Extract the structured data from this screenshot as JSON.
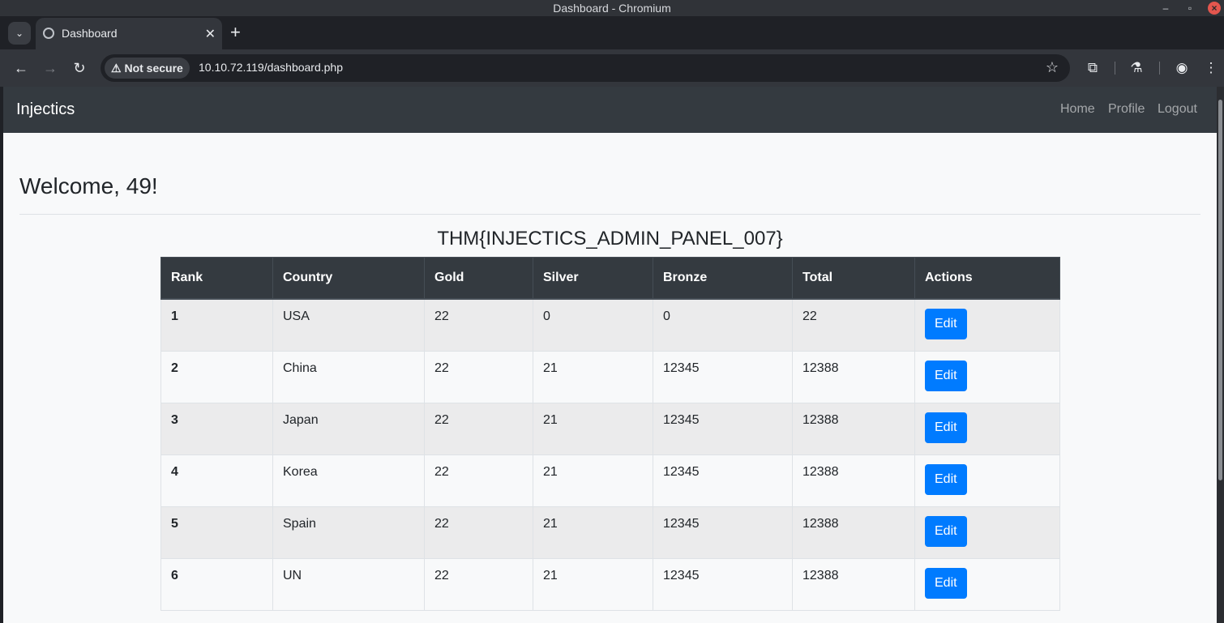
{
  "window": {
    "title": "Dashboard - Chromium"
  },
  "browser": {
    "tab_title": "Dashboard",
    "security_label": "Not secure",
    "url": "10.10.72.119/dashboard.php"
  },
  "nav": {
    "brand": "Injectics",
    "links": [
      "Home",
      "Profile",
      "Logout"
    ]
  },
  "page": {
    "welcome": "Welcome, 49!",
    "flag": "THM{INJECTICS_ADMIN_PANEL_007}"
  },
  "table": {
    "headers": [
      "Rank",
      "Country",
      "Gold",
      "Silver",
      "Bronze",
      "Total",
      "Actions"
    ],
    "edit_label": "Edit",
    "rows": [
      [
        "1",
        "USA",
        "22",
        "0",
        "0",
        "22"
      ],
      [
        "2",
        "China",
        "22",
        "21",
        "12345",
        "12388"
      ],
      [
        "3",
        "Japan",
        "22",
        "21",
        "12345",
        "12388"
      ],
      [
        "4",
        "Korea",
        "22",
        "21",
        "12345",
        "12388"
      ],
      [
        "5",
        "Spain",
        "22",
        "21",
        "12345",
        "12388"
      ],
      [
        "6",
        "UN",
        "22",
        "21",
        "12345",
        "12388"
      ]
    ]
  },
  "colors": {
    "navbar": "#343a40",
    "primary_button": "#007bff",
    "page_bg": "#f8f9fa"
  }
}
